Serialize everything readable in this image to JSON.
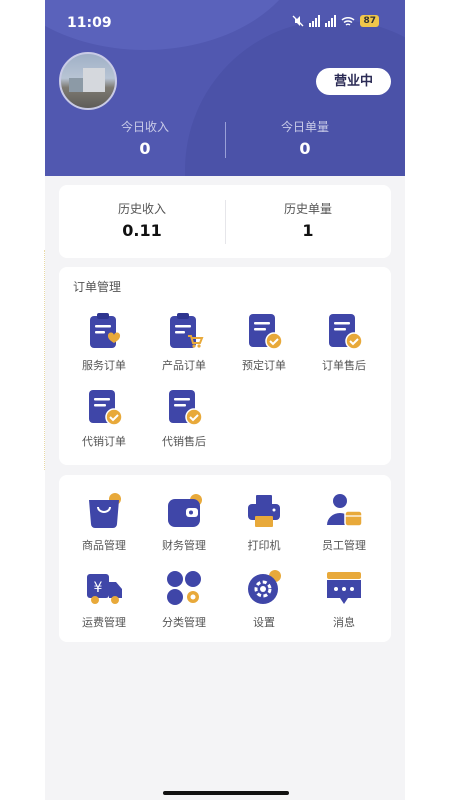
{
  "status_bar": {
    "time": "11:09",
    "battery": "87"
  },
  "header": {
    "open_status": "营业中"
  },
  "today": {
    "income_label": "今日收入",
    "income_value": "0",
    "orders_label": "今日单量",
    "orders_value": "0"
  },
  "history": {
    "income_label": "历史收入",
    "income_value": "0.11",
    "orders_label": "历史单量",
    "orders_value": "1"
  },
  "order_management": {
    "title": "订单管理",
    "items": [
      {
        "label": "服务订单",
        "icon": "service-order-icon"
      },
      {
        "label": "产品订单",
        "icon": "product-order-icon"
      },
      {
        "label": "预定订单",
        "icon": "reservation-order-icon"
      },
      {
        "label": "订单售后",
        "icon": "order-aftersale-icon"
      },
      {
        "label": "代销订单",
        "icon": "consignment-order-icon"
      },
      {
        "label": "代销售后",
        "icon": "consignment-aftersale-icon"
      }
    ]
  },
  "tools": {
    "items": [
      {
        "label": "商品管理",
        "icon": "goods-bag-icon"
      },
      {
        "label": "财务管理",
        "icon": "wallet-icon"
      },
      {
        "label": "打印机",
        "icon": "printer-icon"
      },
      {
        "label": "员工管理",
        "icon": "staff-icon"
      },
      {
        "label": "运费管理",
        "icon": "freight-truck-icon"
      },
      {
        "label": "分类管理",
        "icon": "category-icon"
      },
      {
        "label": "设置",
        "icon": "settings-gear-icon"
      },
      {
        "label": "消息",
        "icon": "message-icon"
      }
    ]
  },
  "colors": {
    "primary": "#5158b0",
    "icon_blue": "#3f46a8",
    "icon_gold": "#e8a93a",
    "background": "#f4f4f6"
  }
}
